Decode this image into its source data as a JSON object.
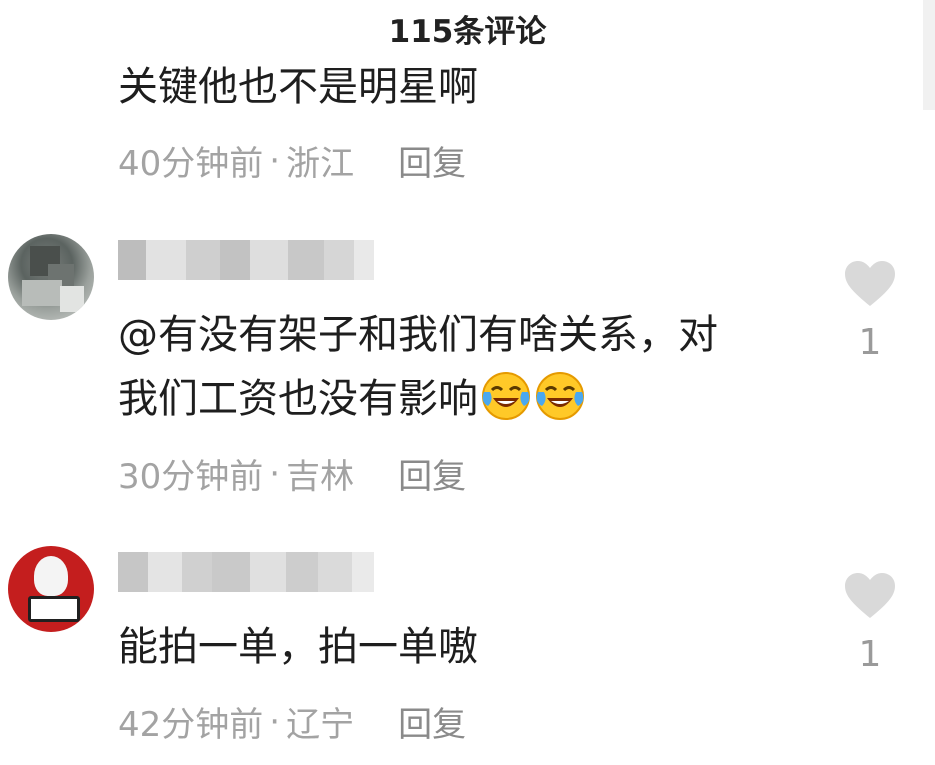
{
  "header": {
    "title": "115条评论"
  },
  "comments": [
    {
      "text": "关键他也不是明星啊",
      "time": "40分钟前",
      "location": "浙江",
      "reply_label": "回复"
    },
    {
      "text_line1": "@有没有架子和我们有啥关系，对",
      "text_line2": "我们工资也没有影响",
      "emoji_icon": "laughing-crying-emoji",
      "time": "30分钟前",
      "location": "吉林",
      "reply_label": "回复",
      "likes": "1"
    },
    {
      "text": "能拍一单，拍一单嗷",
      "time": "42分钟前",
      "location": "辽宁",
      "reply_label": "回复",
      "likes": "1"
    }
  ],
  "separator": "·",
  "colors": {
    "text": "#1e1e1e",
    "meta": "#a3a3a3",
    "heart": "#d9d9d9",
    "avatar2_bg": "#c41e1e"
  }
}
